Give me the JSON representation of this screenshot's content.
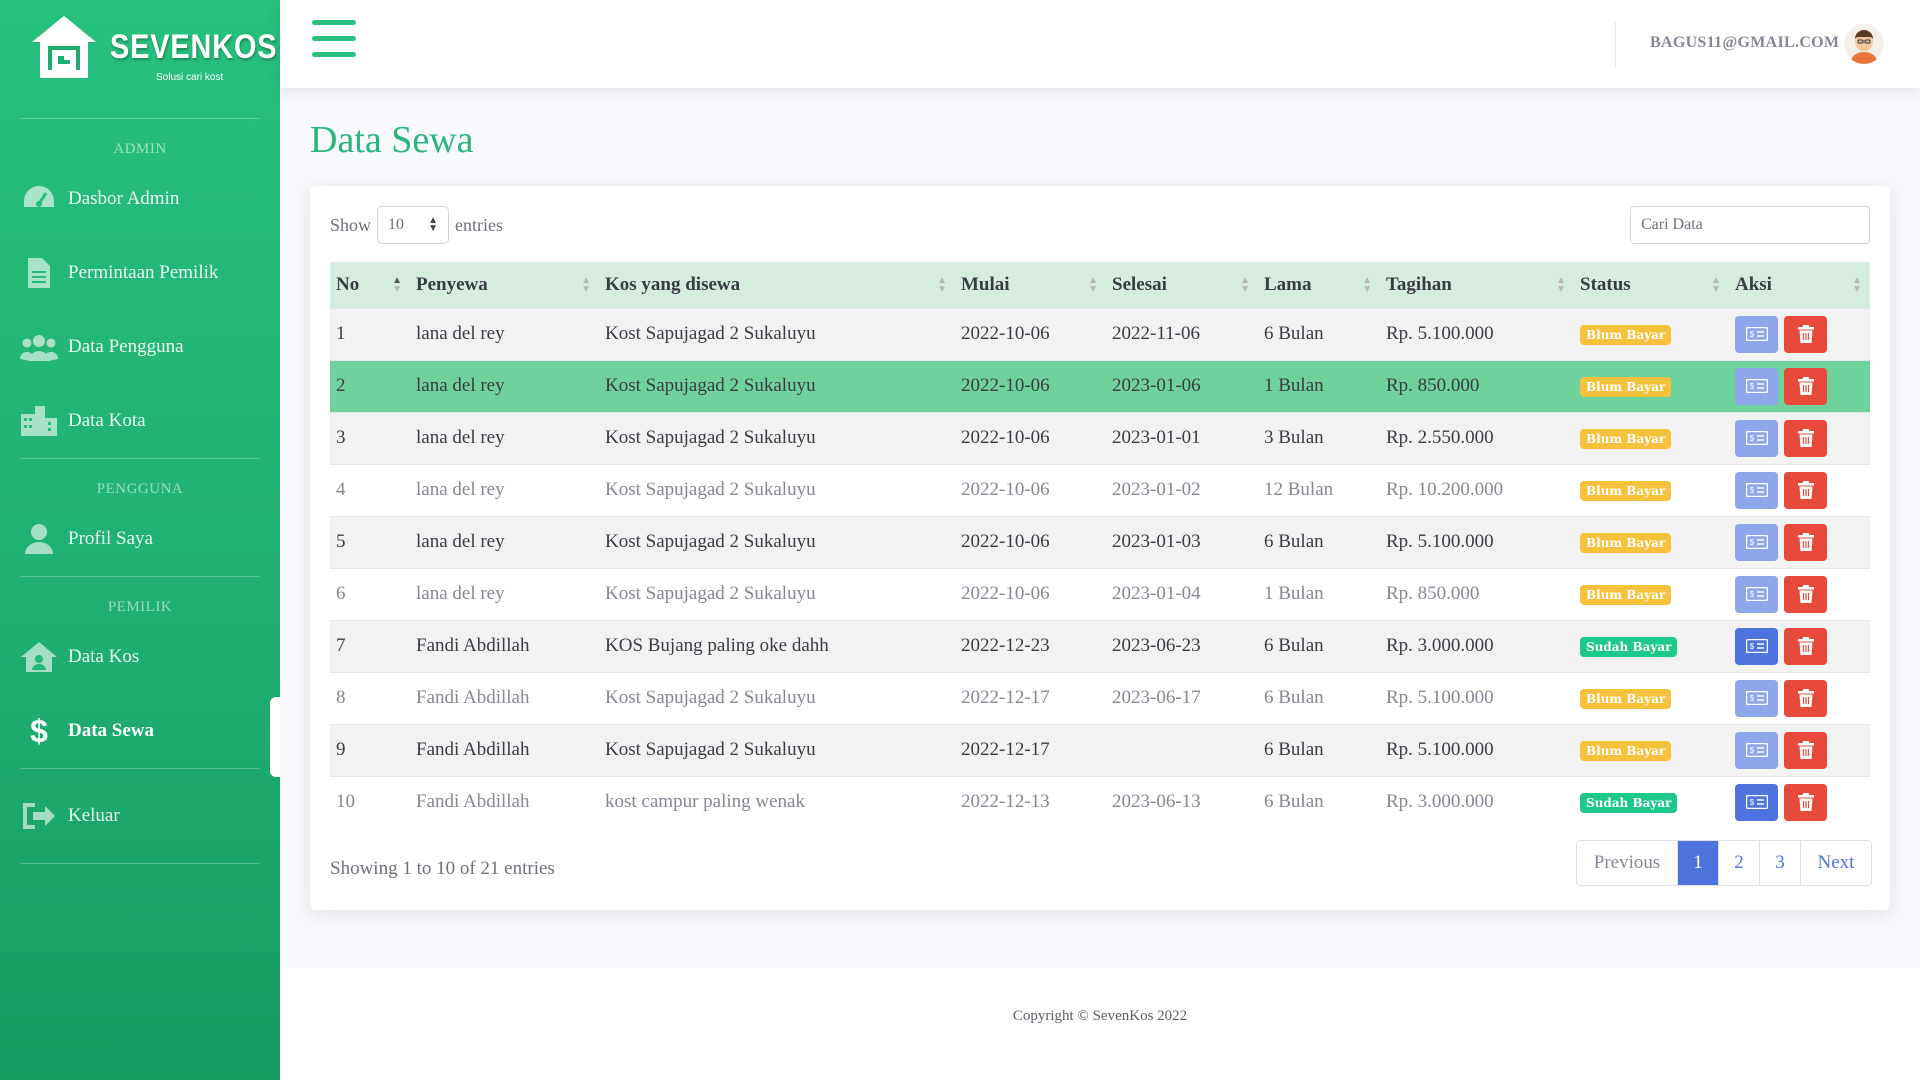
{
  "brand": {
    "name": "SEVENKOS",
    "tagline": "Solusi cari kost"
  },
  "sidebar": {
    "sections": [
      {
        "heading": "ADMIN",
        "items": [
          {
            "label": "Dasbor Admin",
            "icon": "dashboard-icon"
          },
          {
            "label": "Permintaan Pemilik",
            "icon": "file-icon"
          },
          {
            "label": "Data Pengguna",
            "icon": "users-icon"
          },
          {
            "label": "Data Kota",
            "icon": "city-icon"
          }
        ]
      },
      {
        "heading": "PENGGUNA",
        "items": [
          {
            "label": "Profil Saya",
            "icon": "user-icon"
          }
        ]
      },
      {
        "heading": "PEMILIK",
        "items": [
          {
            "label": "Data Kos",
            "icon": "house-user-icon"
          },
          {
            "label": "Data Sewa",
            "icon": "dollar-icon",
            "active": true
          }
        ]
      }
    ],
    "logout": {
      "label": "Keluar",
      "icon": "sign-out-icon"
    }
  },
  "topbar": {
    "user_email": "BAGUS11@GMAIL.COM"
  },
  "page": {
    "title": "Data Sewa"
  },
  "table_controls": {
    "show_label": "Show",
    "page_size": "10",
    "entries_label": "entries",
    "search_placeholder": "Cari Data"
  },
  "table": {
    "columns": [
      "No",
      "Penyewa",
      "Kos yang disewa",
      "Mulai",
      "Selesai",
      "Lama",
      "Tagihan",
      "Status",
      "Aksi"
    ],
    "rows": [
      {
        "no": "1",
        "penyewa": "lana del rey",
        "kos": "Kost Sapujagad 2 Sukaluyu",
        "mulai": "2022-10-06",
        "selesai": "2022-11-06",
        "lama": "6 Bulan",
        "tagihan": "Rp. 5.100.000",
        "status": "Blum Bayar"
      },
      {
        "no": "2",
        "penyewa": "lana del rey",
        "kos": "Kost Sapujagad 2 Sukaluyu",
        "mulai": "2022-10-06",
        "selesai": "2023-01-06",
        "lama": "1 Bulan",
        "tagihan": "Rp. 850.000",
        "status": "Blum Bayar"
      },
      {
        "no": "3",
        "penyewa": "lana del rey",
        "kos": "Kost Sapujagad 2 Sukaluyu",
        "mulai": "2022-10-06",
        "selesai": "2023-01-01",
        "lama": "3 Bulan",
        "tagihan": "Rp. 2.550.000",
        "status": "Blum Bayar"
      },
      {
        "no": "4",
        "penyewa": "lana del rey",
        "kos": "Kost Sapujagad 2 Sukaluyu",
        "mulai": "2022-10-06",
        "selesai": "2023-01-02",
        "lama": "12 Bulan",
        "tagihan": "Rp. 10.200.000",
        "status": "Blum Bayar"
      },
      {
        "no": "5",
        "penyewa": "lana del rey",
        "kos": "Kost Sapujagad 2 Sukaluyu",
        "mulai": "2022-10-06",
        "selesai": "2023-01-03",
        "lama": "6 Bulan",
        "tagihan": "Rp. 5.100.000",
        "status": "Blum Bayar"
      },
      {
        "no": "6",
        "penyewa": "lana del rey",
        "kos": "Kost Sapujagad 2 Sukaluyu",
        "mulai": "2022-10-06",
        "selesai": "2023-01-04",
        "lama": "1 Bulan",
        "tagihan": "Rp. 850.000",
        "status": "Blum Bayar"
      },
      {
        "no": "7",
        "penyewa": "Fandi Abdillah",
        "kos": "KOS Bujang paling oke dahh",
        "mulai": "2022-12-23",
        "selesai": "2023-06-23",
        "lama": "6 Bulan",
        "tagihan": "Rp. 3.000.000",
        "status": "Sudah Bayar"
      },
      {
        "no": "8",
        "penyewa": "Fandi Abdillah",
        "kos": "Kost Sapujagad 2 Sukaluyu",
        "mulai": "2022-12-17",
        "selesai": "2023-06-17",
        "lama": "6 Bulan",
        "tagihan": "Rp. 5.100.000",
        "status": "Blum Bayar"
      },
      {
        "no": "9",
        "penyewa": "Fandi Abdillah",
        "kos": "Kost Sapujagad 2 Sukaluyu",
        "mulai": "2022-12-17",
        "selesai": "",
        "lama": "6 Bulan",
        "tagihan": "Rp. 5.100.000",
        "status": "Blum Bayar"
      },
      {
        "no": "10",
        "penyewa": "Fandi Abdillah",
        "kos": "kost campur paling wenak",
        "mulai": "2022-12-13",
        "selesai": "2023-06-13",
        "lama": "6 Bulan",
        "tagihan": "Rp. 3.000.000",
        "status": "Sudah Bayar"
      }
    ]
  },
  "pagination": {
    "info": "Showing 1 to 10 of 21 entries",
    "previous": "Previous",
    "pages": [
      "1",
      "2",
      "3"
    ],
    "next": "Next"
  },
  "footer": {
    "copyright": "Copyright © SevenKos 2022"
  },
  "colors": {
    "accent": "#27c07d",
    "primary": "#4e73df",
    "danger": "#e74a3b",
    "warning": "#f6c23e",
    "success": "#1cc88a"
  }
}
